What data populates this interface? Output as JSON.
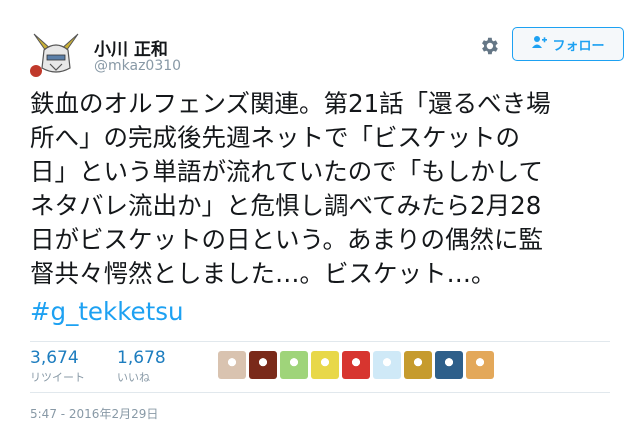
{
  "user": {
    "name": "小川 正和",
    "handle": "@mkaz0310"
  },
  "follow_button": {
    "label": "フォロー"
  },
  "tweet": {
    "text": "鉄血のオルフェンズ関連。第21話「還るべき場\n所へ」の完成後先週ネットで「ビスケットの\n日」という単語が流れていたので「もしかして\nネタバレ流出か」と危惧し調べてみたら2月28\n日がビスケットの日という。あまりの偶然に監\n督共々愕然としました…。ビスケット…。",
    "hashtag": "#g_tekketsu",
    "timestamp": "5:47 - 2016年2月29日"
  },
  "stats": {
    "retweets": {
      "count": "3,674",
      "label": "リツイート"
    },
    "likes": {
      "count": "1,678",
      "label": "いいね"
    }
  },
  "colors": {
    "accent": "#1da1f2",
    "count": "#1d7dbf",
    "muted": "#8899a6"
  },
  "icons": [
    "gear-icon",
    "follow-person-icon"
  ],
  "liker_avatars": [
    {
      "color": "#d9c3b0"
    },
    {
      "color": "#7a2a1a"
    },
    {
      "color": "#9fd47a"
    },
    {
      "color": "#e8d84a"
    },
    {
      "color": "#d7352f"
    },
    {
      "color": "#cfe9f7"
    },
    {
      "color": "#c69b2e"
    },
    {
      "color": "#2e5f8a"
    },
    {
      "color": "#e3a85a"
    }
  ]
}
